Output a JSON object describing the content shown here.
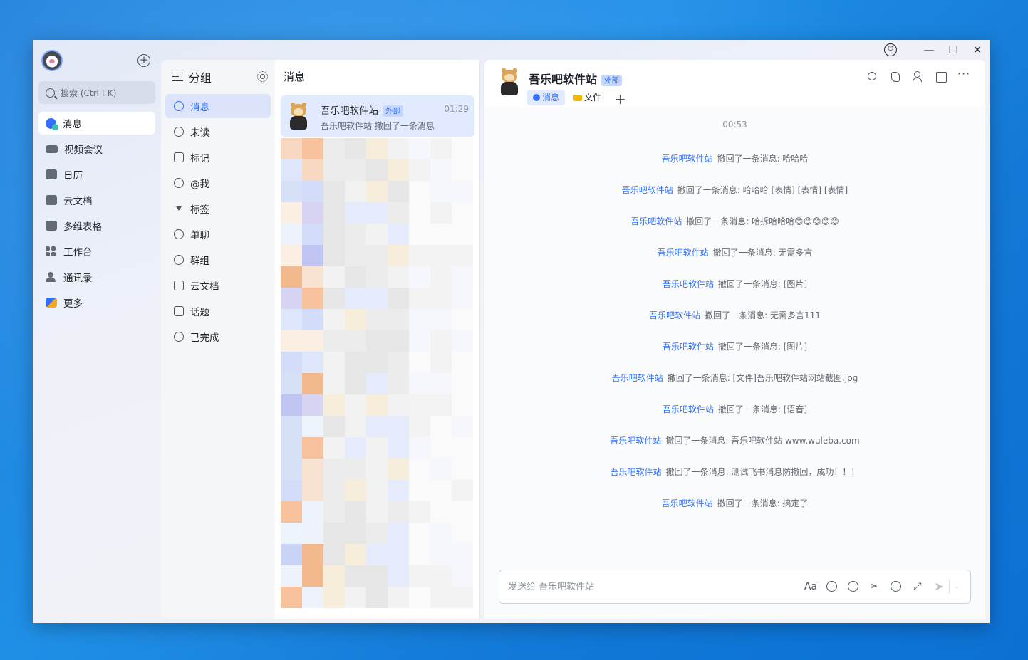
{
  "colors": {
    "accent": "#3370ff",
    "active_bg": "#e1eaff",
    "external_tag_bg": "#c7d6fb"
  },
  "nav": {
    "search_placeholder": "搜索 (Ctrl＋K)",
    "add_icon": "plus-circle-icon",
    "items": [
      {
        "label": "消息",
        "icon": "message-icon",
        "active": true
      },
      {
        "label": "视频会议",
        "icon": "video-icon"
      },
      {
        "label": "日历",
        "icon": "calendar-icon"
      },
      {
        "label": "云文档",
        "icon": "doc-icon"
      },
      {
        "label": "多维表格",
        "icon": "table-icon"
      },
      {
        "label": "工作台",
        "icon": "workspace-icon"
      },
      {
        "label": "通讯录",
        "icon": "contacts-icon"
      },
      {
        "label": "更多",
        "icon": "more-apps-icon"
      }
    ]
  },
  "groups": {
    "title": "分组",
    "items": [
      {
        "label": "消息",
        "active": true
      },
      {
        "label": "未读"
      },
      {
        "label": "标记"
      },
      {
        "label": "@我"
      },
      {
        "label": "标签"
      },
      {
        "label": "单聊"
      },
      {
        "label": "群组"
      },
      {
        "label": "云文档"
      },
      {
        "label": "话题"
      },
      {
        "label": "已完成"
      }
    ]
  },
  "chat_list": {
    "title": "消息",
    "selected": {
      "name": "吾乐吧软件站",
      "tag": "外部",
      "time": "01:29",
      "preview": "吾乐吧软件站 撤回了一条消息"
    }
  },
  "conversation": {
    "title": "吾乐吧软件站",
    "tag": "外部",
    "tabs": [
      {
        "label": "消息",
        "active": true
      },
      {
        "label": "文件"
      }
    ],
    "add_tab": "＋",
    "timestamp": "00:53",
    "messages": [
      {
        "who": "吾乐吧软件站",
        "text": "撤回了一条消息: 哈哈哈"
      },
      {
        "who": "吾乐吧软件站",
        "text": "撤回了一条消息: 哈哈哈 [表情] [表情] [表情]"
      },
      {
        "who": "吾乐吧软件站",
        "text": "撤回了一条消息: 哈拆哈哈哈😊😊😊😊😊"
      },
      {
        "who": "吾乐吧软件站",
        "text": "撤回了一条消息: 无需多言"
      },
      {
        "who": "吾乐吧软件站",
        "text": "撤回了一条消息: [图片]"
      },
      {
        "who": "吾乐吧软件站",
        "text": "撤回了一条消息: 无需多言111"
      },
      {
        "who": "吾乐吧软件站",
        "text": "撤回了一条消息: [图片]"
      },
      {
        "who": "吾乐吧软件站",
        "text": "撤回了一条消息: [文件]吾乐吧软件站网站截图.jpg"
      },
      {
        "who": "吾乐吧软件站",
        "text": "撤回了一条消息: [语音]"
      },
      {
        "who": "吾乐吧软件站",
        "text": "撤回了一条消息: 吾乐吧软件站 www.wuleba.com"
      },
      {
        "who": "吾乐吧软件站",
        "text": "撤回了一条消息: 测试飞书消息防撤回，成功！！！"
      },
      {
        "who": "吾乐吧软件站",
        "text": "撤回了一条消息: 搞定了"
      }
    ],
    "composer": {
      "placeholder": "发送给 吾乐吧软件站",
      "value": "",
      "format_label": "Aa"
    }
  }
}
